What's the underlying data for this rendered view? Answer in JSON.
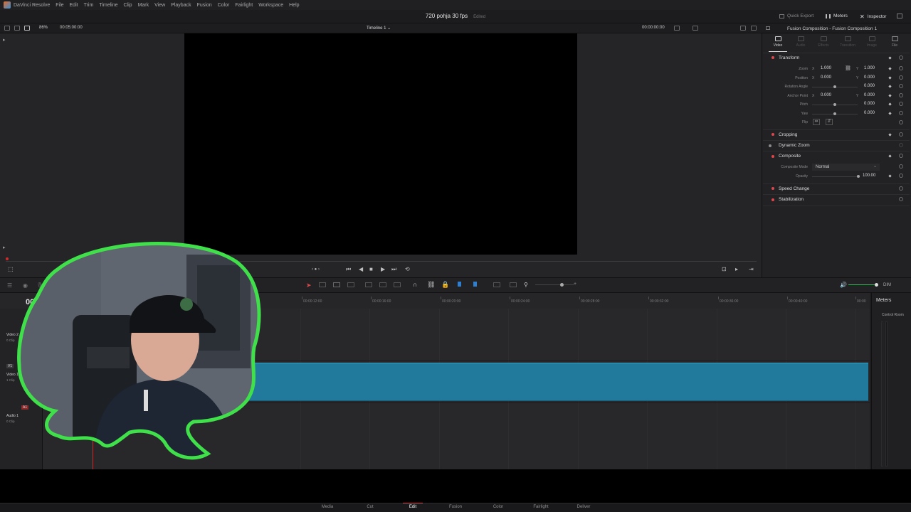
{
  "menubar": {
    "app_name": "DaVinci Resolve",
    "items": [
      "File",
      "Edit",
      "Trim",
      "Timeline",
      "Clip",
      "Mark",
      "View",
      "Playback",
      "Fusion",
      "Color",
      "Fairlight",
      "Workspace",
      "Help"
    ]
  },
  "titlebar": {
    "project": "720 pohja  30 fps",
    "status": "Edited",
    "quick_export": "Quick Export",
    "meters": "Meters",
    "inspector": "Inspector"
  },
  "viewer": {
    "zoom": "86%",
    "timecode_left": "00:05:00:00",
    "timeline_name": "Timeline 1",
    "timecode_right": "00:00:00:00"
  },
  "inspector": {
    "title": "Fusion Composition - Fusion Composition 1",
    "tabs": [
      "Video",
      "Audio",
      "Effects",
      "Transition",
      "Image",
      "File"
    ],
    "active_tab": "Video",
    "sections": {
      "transform": "Transform",
      "cropping": "Cropping",
      "dynamic_zoom": "Dynamic Zoom",
      "composite": "Composite",
      "speed_change": "Speed Change",
      "stabilization": "Stabilization"
    },
    "fields": {
      "zoom_label": "Zoom",
      "zoom_x": "1.000",
      "zoom_y": "1.000",
      "position_label": "Position",
      "position_x": "0.000",
      "position_y": "0.000",
      "rotation_label": "Rotation Angle",
      "rotation": "0.000",
      "anchor_label": "Anchor Point",
      "anchor_x": "0.000",
      "anchor_y": "0.000",
      "pitch_label": "Pitch",
      "pitch": "0.000",
      "yaw_label": "Yaw",
      "yaw": "0.000",
      "flip_label": "Flip",
      "x_axis": "X",
      "y_axis": "Y",
      "composite_mode_label": "Composite Mode",
      "composite_mode": "Normal",
      "opacity_label": "Opacity",
      "opacity": "100.00"
    }
  },
  "timeline": {
    "timecode": "00:",
    "ruler": [
      "00:00:12:00",
      "00:00:16:00",
      "00:00:20:00",
      "00:00:24:00",
      "00:00:28:00",
      "00:00:32:00",
      "00:00:36:00",
      "00:00:40:00",
      "00:00"
    ],
    "tracks": {
      "v2_name": "Video 2",
      "v2_clips": "0 Clip",
      "v1_badge": "V1",
      "v1_name": "Video 1",
      "v1_clips": "1 Clip",
      "a1_badge": "A1",
      "a1_name": "Audio 1",
      "a1_clips": "0 Clip"
    },
    "volume_label": "DIM"
  },
  "meters": {
    "title": "Meters",
    "channel": "Control Room"
  },
  "pages": [
    "Media",
    "Cut",
    "Edit",
    "Fusion",
    "Color",
    "Fairlight",
    "Deliver"
  ],
  "active_page": "Edit"
}
